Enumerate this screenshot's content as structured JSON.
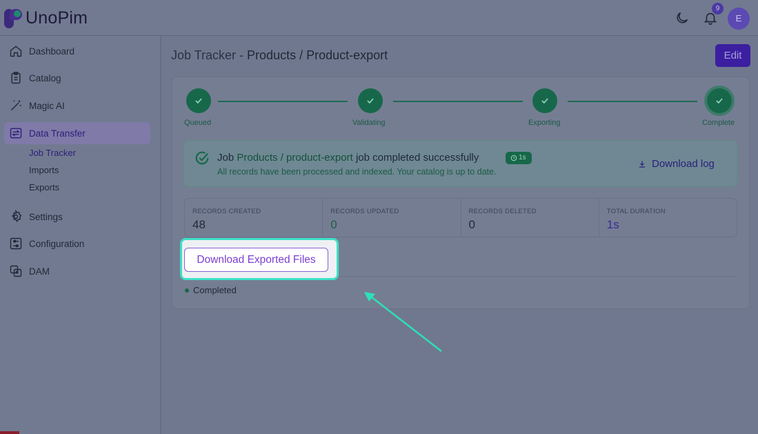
{
  "app": {
    "logo_text": "UnoPim"
  },
  "topbar": {
    "notification_count": "9",
    "avatar_initial": "E"
  },
  "sidebar": {
    "items": [
      {
        "label": "Dashboard",
        "icon": "home-icon"
      },
      {
        "label": "Catalog",
        "icon": "clipboard-icon"
      },
      {
        "label": "Magic AI",
        "icon": "magic-wand-icon"
      },
      {
        "label": "Data Transfer",
        "icon": "data-transfer-icon"
      },
      {
        "label": "Settings",
        "icon": "gear-icon"
      },
      {
        "label": "Configuration",
        "icon": "sliders-icon"
      },
      {
        "label": "DAM",
        "icon": "images-icon"
      }
    ],
    "sub_items": [
      "Job Tracker",
      "Imports",
      "Exports"
    ]
  },
  "page": {
    "title_prefix": "Job Tracker",
    "title_sep": " - ",
    "title_main": "Products / Product-export",
    "edit_label": "Edit"
  },
  "steps": [
    "Queued",
    "Validating",
    "Exporting",
    "Complete"
  ],
  "success": {
    "prefix": "Job ",
    "job_name": "Products / product-export",
    "suffix": " job completed successfully",
    "duration_badge": "1s",
    "subtitle": "All records have been processed and indexed. Your catalog is up to date.",
    "download_log": "Download log"
  },
  "stats": [
    {
      "key": "RECORDS CREATED",
      "value": "48"
    },
    {
      "key": "RECORDS UPDATED",
      "value": "0"
    },
    {
      "key": "RECORDS DELETED",
      "value": "0"
    },
    {
      "key": "TOTAL DURATION",
      "value": "1s"
    }
  ],
  "download_files_label": "Download Exported Files",
  "status_text": "Completed",
  "colors": {
    "accent": "#3b1fa0",
    "success": "#17684a",
    "highlight": "#3ee0c6"
  }
}
